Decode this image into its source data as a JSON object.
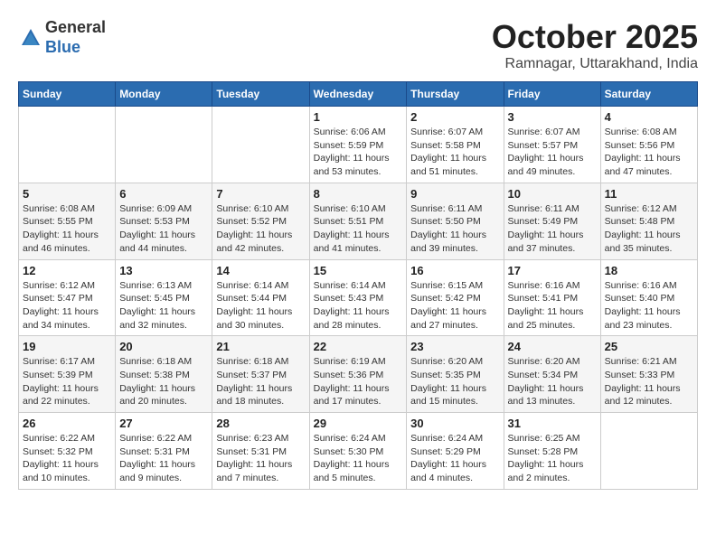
{
  "header": {
    "logo_line1": "General",
    "logo_line2": "Blue",
    "month": "October 2025",
    "location": "Ramnagar, Uttarakhand, India"
  },
  "days_of_week": [
    "Sunday",
    "Monday",
    "Tuesday",
    "Wednesday",
    "Thursday",
    "Friday",
    "Saturday"
  ],
  "weeks": [
    [
      {
        "day": "",
        "info": ""
      },
      {
        "day": "",
        "info": ""
      },
      {
        "day": "",
        "info": ""
      },
      {
        "day": "1",
        "info": "Sunrise: 6:06 AM\nSunset: 5:59 PM\nDaylight: 11 hours and 53 minutes."
      },
      {
        "day": "2",
        "info": "Sunrise: 6:07 AM\nSunset: 5:58 PM\nDaylight: 11 hours and 51 minutes."
      },
      {
        "day": "3",
        "info": "Sunrise: 6:07 AM\nSunset: 5:57 PM\nDaylight: 11 hours and 49 minutes."
      },
      {
        "day": "4",
        "info": "Sunrise: 6:08 AM\nSunset: 5:56 PM\nDaylight: 11 hours and 47 minutes."
      }
    ],
    [
      {
        "day": "5",
        "info": "Sunrise: 6:08 AM\nSunset: 5:55 PM\nDaylight: 11 hours and 46 minutes."
      },
      {
        "day": "6",
        "info": "Sunrise: 6:09 AM\nSunset: 5:53 PM\nDaylight: 11 hours and 44 minutes."
      },
      {
        "day": "7",
        "info": "Sunrise: 6:10 AM\nSunset: 5:52 PM\nDaylight: 11 hours and 42 minutes."
      },
      {
        "day": "8",
        "info": "Sunrise: 6:10 AM\nSunset: 5:51 PM\nDaylight: 11 hours and 41 minutes."
      },
      {
        "day": "9",
        "info": "Sunrise: 6:11 AM\nSunset: 5:50 PM\nDaylight: 11 hours and 39 minutes."
      },
      {
        "day": "10",
        "info": "Sunrise: 6:11 AM\nSunset: 5:49 PM\nDaylight: 11 hours and 37 minutes."
      },
      {
        "day": "11",
        "info": "Sunrise: 6:12 AM\nSunset: 5:48 PM\nDaylight: 11 hours and 35 minutes."
      }
    ],
    [
      {
        "day": "12",
        "info": "Sunrise: 6:12 AM\nSunset: 5:47 PM\nDaylight: 11 hours and 34 minutes."
      },
      {
        "day": "13",
        "info": "Sunrise: 6:13 AM\nSunset: 5:45 PM\nDaylight: 11 hours and 32 minutes."
      },
      {
        "day": "14",
        "info": "Sunrise: 6:14 AM\nSunset: 5:44 PM\nDaylight: 11 hours and 30 minutes."
      },
      {
        "day": "15",
        "info": "Sunrise: 6:14 AM\nSunset: 5:43 PM\nDaylight: 11 hours and 28 minutes."
      },
      {
        "day": "16",
        "info": "Sunrise: 6:15 AM\nSunset: 5:42 PM\nDaylight: 11 hours and 27 minutes."
      },
      {
        "day": "17",
        "info": "Sunrise: 6:16 AM\nSunset: 5:41 PM\nDaylight: 11 hours and 25 minutes."
      },
      {
        "day": "18",
        "info": "Sunrise: 6:16 AM\nSunset: 5:40 PM\nDaylight: 11 hours and 23 minutes."
      }
    ],
    [
      {
        "day": "19",
        "info": "Sunrise: 6:17 AM\nSunset: 5:39 PM\nDaylight: 11 hours and 22 minutes."
      },
      {
        "day": "20",
        "info": "Sunrise: 6:18 AM\nSunset: 5:38 PM\nDaylight: 11 hours and 20 minutes."
      },
      {
        "day": "21",
        "info": "Sunrise: 6:18 AM\nSunset: 5:37 PM\nDaylight: 11 hours and 18 minutes."
      },
      {
        "day": "22",
        "info": "Sunrise: 6:19 AM\nSunset: 5:36 PM\nDaylight: 11 hours and 17 minutes."
      },
      {
        "day": "23",
        "info": "Sunrise: 6:20 AM\nSunset: 5:35 PM\nDaylight: 11 hours and 15 minutes."
      },
      {
        "day": "24",
        "info": "Sunrise: 6:20 AM\nSunset: 5:34 PM\nDaylight: 11 hours and 13 minutes."
      },
      {
        "day": "25",
        "info": "Sunrise: 6:21 AM\nSunset: 5:33 PM\nDaylight: 11 hours and 12 minutes."
      }
    ],
    [
      {
        "day": "26",
        "info": "Sunrise: 6:22 AM\nSunset: 5:32 PM\nDaylight: 11 hours and 10 minutes."
      },
      {
        "day": "27",
        "info": "Sunrise: 6:22 AM\nSunset: 5:31 PM\nDaylight: 11 hours and 9 minutes."
      },
      {
        "day": "28",
        "info": "Sunrise: 6:23 AM\nSunset: 5:31 PM\nDaylight: 11 hours and 7 minutes."
      },
      {
        "day": "29",
        "info": "Sunrise: 6:24 AM\nSunset: 5:30 PM\nDaylight: 11 hours and 5 minutes."
      },
      {
        "day": "30",
        "info": "Sunrise: 6:24 AM\nSunset: 5:29 PM\nDaylight: 11 hours and 4 minutes."
      },
      {
        "day": "31",
        "info": "Sunrise: 6:25 AM\nSunset: 5:28 PM\nDaylight: 11 hours and 2 minutes."
      },
      {
        "day": "",
        "info": ""
      }
    ]
  ]
}
